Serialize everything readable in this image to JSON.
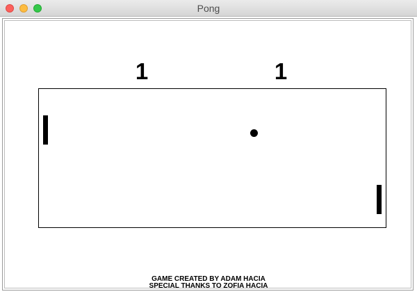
{
  "window": {
    "title": "Pong"
  },
  "scoreboard": {
    "left_score": "1",
    "right_score": "1"
  },
  "credits": {
    "line1": "GAME CREATED BY ADAM HACIA",
    "line2": "SPECIAL THANKS TO ZOFIA HACIA"
  },
  "colors": {
    "background": "#ffffff",
    "foreground": "#000000"
  }
}
